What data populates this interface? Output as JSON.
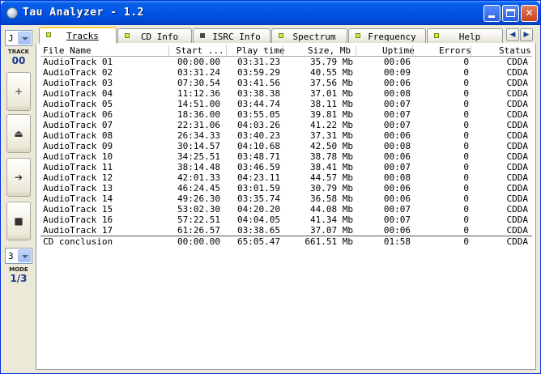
{
  "window": {
    "title": "Tau Analyzer - 1.2"
  },
  "left_panel": {
    "drive_value": "J",
    "track_label": "TRACK",
    "track_value": "00",
    "mode_select_value": "3",
    "mode_label": "MODE",
    "mode_value": "1/3",
    "buttons": [
      {
        "icon": "plus-icon",
        "glyph": "+"
      },
      {
        "icon": "eject-icon",
        "glyph": "⏏"
      },
      {
        "icon": "play-arrow-icon",
        "glyph": "➔"
      },
      {
        "icon": "stop-icon",
        "glyph": "■"
      }
    ]
  },
  "tabs": [
    {
      "label": "Tracks",
      "led": "green",
      "active": true
    },
    {
      "label": "CD Info",
      "led": "green",
      "active": false
    },
    {
      "label": "ISRC Info",
      "led": "gray",
      "active": false
    },
    {
      "label": "Spectrum",
      "led": "green",
      "active": false
    },
    {
      "label": "Frequency",
      "led": "green",
      "active": false
    },
    {
      "label": "Help",
      "led": "green",
      "active": false
    }
  ],
  "table": {
    "columns": [
      "File Name",
      "Start ...",
      "Play time",
      "Size, Mb",
      "Uptime",
      "Errors",
      "Status"
    ],
    "rows": [
      [
        "AudioTrack 01",
        "00:00.00",
        "03:31.23",
        "35.79 Mb",
        "00:06",
        "0",
        "CDDA"
      ],
      [
        "AudioTrack 02",
        "03:31.24",
        "03:59.29",
        "40.55 Mb",
        "00:09",
        "0",
        "CDDA"
      ],
      [
        "AudioTrack 03",
        "07:30.54",
        "03:41.56",
        "37.56 Mb",
        "00:06",
        "0",
        "CDDA"
      ],
      [
        "AudioTrack 04",
        "11:12.36",
        "03:38.38",
        "37.01 Mb",
        "00:08",
        "0",
        "CDDA"
      ],
      [
        "AudioTrack 05",
        "14:51.00",
        "03:44.74",
        "38.11 Mb",
        "00:07",
        "0",
        "CDDA"
      ],
      [
        "AudioTrack 06",
        "18:36.00",
        "03:55.05",
        "39.81 Mb",
        "00:07",
        "0",
        "CDDA"
      ],
      [
        "AudioTrack 07",
        "22:31.06",
        "04:03.26",
        "41.22 Mb",
        "00:07",
        "0",
        "CDDA"
      ],
      [
        "AudioTrack 08",
        "26:34.33",
        "03:40.23",
        "37.31 Mb",
        "00:06",
        "0",
        "CDDA"
      ],
      [
        "AudioTrack 09",
        "30:14.57",
        "04:10.68",
        "42.50 Mb",
        "00:08",
        "0",
        "CDDA"
      ],
      [
        "AudioTrack 10",
        "34:25.51",
        "03:48.71",
        "38.78 Mb",
        "00:06",
        "0",
        "CDDA"
      ],
      [
        "AudioTrack 11",
        "38:14.48",
        "03:46.59",
        "38.41 Mb",
        "00:07",
        "0",
        "CDDA"
      ],
      [
        "AudioTrack 12",
        "42:01.33",
        "04:23.11",
        "44.57 Mb",
        "00:08",
        "0",
        "CDDA"
      ],
      [
        "AudioTrack 13",
        "46:24.45",
        "03:01.59",
        "30.79 Mb",
        "00:06",
        "0",
        "CDDA"
      ],
      [
        "AudioTrack 14",
        "49:26.30",
        "03:35.74",
        "36.58 Mb",
        "00:06",
        "0",
        "CDDA"
      ],
      [
        "AudioTrack 15",
        "53:02.30",
        "04:20.20",
        "44.08 Mb",
        "00:07",
        "0",
        "CDDA"
      ],
      [
        "AudioTrack 16",
        "57:22.51",
        "04:04.05",
        "41.34 Mb",
        "00:07",
        "0",
        "CDDA"
      ],
      [
        "AudioTrack 17",
        "61:26.57",
        "03:38.65",
        "37.07 Mb",
        "00:06",
        "0",
        "CDDA"
      ]
    ],
    "summary": [
      "CD conclusion",
      "00:00.00",
      "65:05.47",
      "661.51 Mb",
      "01:58",
      "0",
      "CDDA"
    ]
  }
}
